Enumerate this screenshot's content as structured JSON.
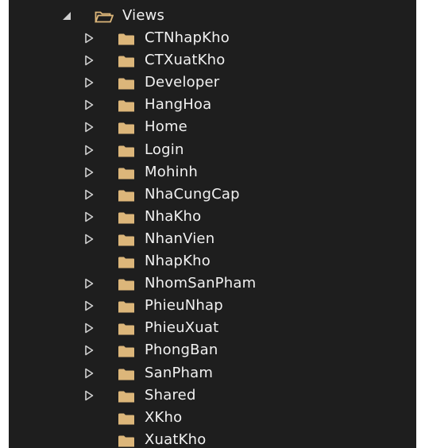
{
  "tree": {
    "root": {
      "label": "Views",
      "expanded": true
    },
    "items": [
      {
        "label": "CTNhapKho",
        "has_children": true
      },
      {
        "label": "CTXuatKho",
        "has_children": true
      },
      {
        "label": "Developer",
        "has_children": true
      },
      {
        "label": "HangHoa",
        "has_children": true
      },
      {
        "label": "Home",
        "has_children": true
      },
      {
        "label": "Login",
        "has_children": true
      },
      {
        "label": "Mohinh",
        "has_children": true
      },
      {
        "label": "NhaCungCap",
        "has_children": true
      },
      {
        "label": "NhaKho",
        "has_children": true
      },
      {
        "label": "NhanVien",
        "has_children": true
      },
      {
        "label": "NhapKho",
        "has_children": false
      },
      {
        "label": "NhomSanPham",
        "has_children": true
      },
      {
        "label": "PhieuNhap",
        "has_children": true
      },
      {
        "label": "PhieuXuat",
        "has_children": true
      },
      {
        "label": "PhongBan",
        "has_children": true
      },
      {
        "label": "SanPham",
        "has_children": true
      },
      {
        "label": "Shared",
        "has_children": true
      },
      {
        "label": "XKho",
        "has_children": false
      },
      {
        "label": "XuatKho",
        "has_children": false
      }
    ]
  },
  "colors": {
    "background": "#1e1e1e",
    "text": "#f1f1f1",
    "folder": "#dcb67a",
    "arrow": "#d0d0d0"
  },
  "icons": {
    "expanded": "expanded-triangle-icon",
    "collapsed": "collapsed-triangle-icon",
    "folder_open": "folder-open-icon",
    "folder": "folder-icon"
  }
}
